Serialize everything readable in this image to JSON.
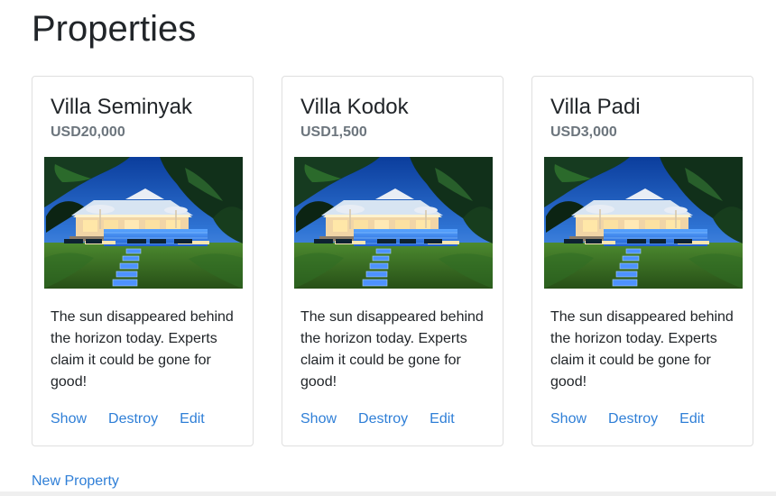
{
  "page": {
    "title": "Properties",
    "new_property_label": "New Property"
  },
  "properties": [
    {
      "name": "Villa Seminyak",
      "price": "USD20,000",
      "description": "The sun disappeared behind the horizon today. Experts claim it could be gone for good!",
      "actions": {
        "show": "Show",
        "destroy": "Destroy",
        "edit": "Edit"
      }
    },
    {
      "name": "Villa Kodok",
      "price": "USD1,500",
      "description": "The sun disappeared behind the horizon today. Experts claim it could be gone for good!",
      "actions": {
        "show": "Show",
        "destroy": "Destroy",
        "edit": "Edit"
      }
    },
    {
      "name": "Villa Padi",
      "price": "USD3,000",
      "description": "The sun disappeared behind the horizon today. Experts claim it could be gone for good!",
      "actions": {
        "show": "Show",
        "destroy": "Destroy",
        "edit": "Edit"
      }
    }
  ],
  "colors": {
    "link": "#2f7fd7",
    "muted_price": "#6c757d",
    "card_border": "#dfdfdf",
    "sky": "#1f5fbf",
    "pool": "#2f7fdf",
    "lawn": "#3f7a25",
    "foliage": "#16351b"
  }
}
